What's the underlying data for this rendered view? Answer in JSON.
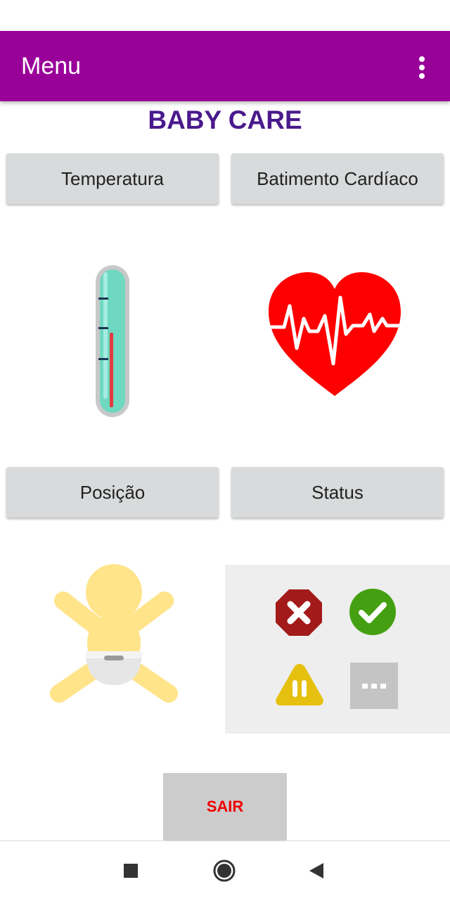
{
  "app_bar": {
    "title": "Menu",
    "overflow_icon": "more-vert-icon",
    "background": "#990099"
  },
  "brand": {
    "title": "BABY CARE",
    "color": "#4a1a8c"
  },
  "buttons": {
    "temperature": "Temperatura",
    "heart_rate": "Batimento Cardíaco",
    "position": "Posição",
    "status": "Status",
    "exit": "SAIR"
  },
  "icons": {
    "temperature": "thermometer-icon",
    "heart_rate": "heart-pulse-icon",
    "position": "baby-icon",
    "status_items": [
      "error-octagon-icon",
      "check-circle-icon",
      "warning-pause-icon",
      "more-dots-icon"
    ]
  },
  "colors": {
    "exit_text": "#ee0000",
    "heart": "#ff0000",
    "error": "#a31a1a",
    "ok": "#44a011",
    "warning": "#e6c00e"
  },
  "nav_bar": {
    "icons": [
      "square-recents-icon",
      "circle-home-icon",
      "triangle-back-icon"
    ]
  }
}
